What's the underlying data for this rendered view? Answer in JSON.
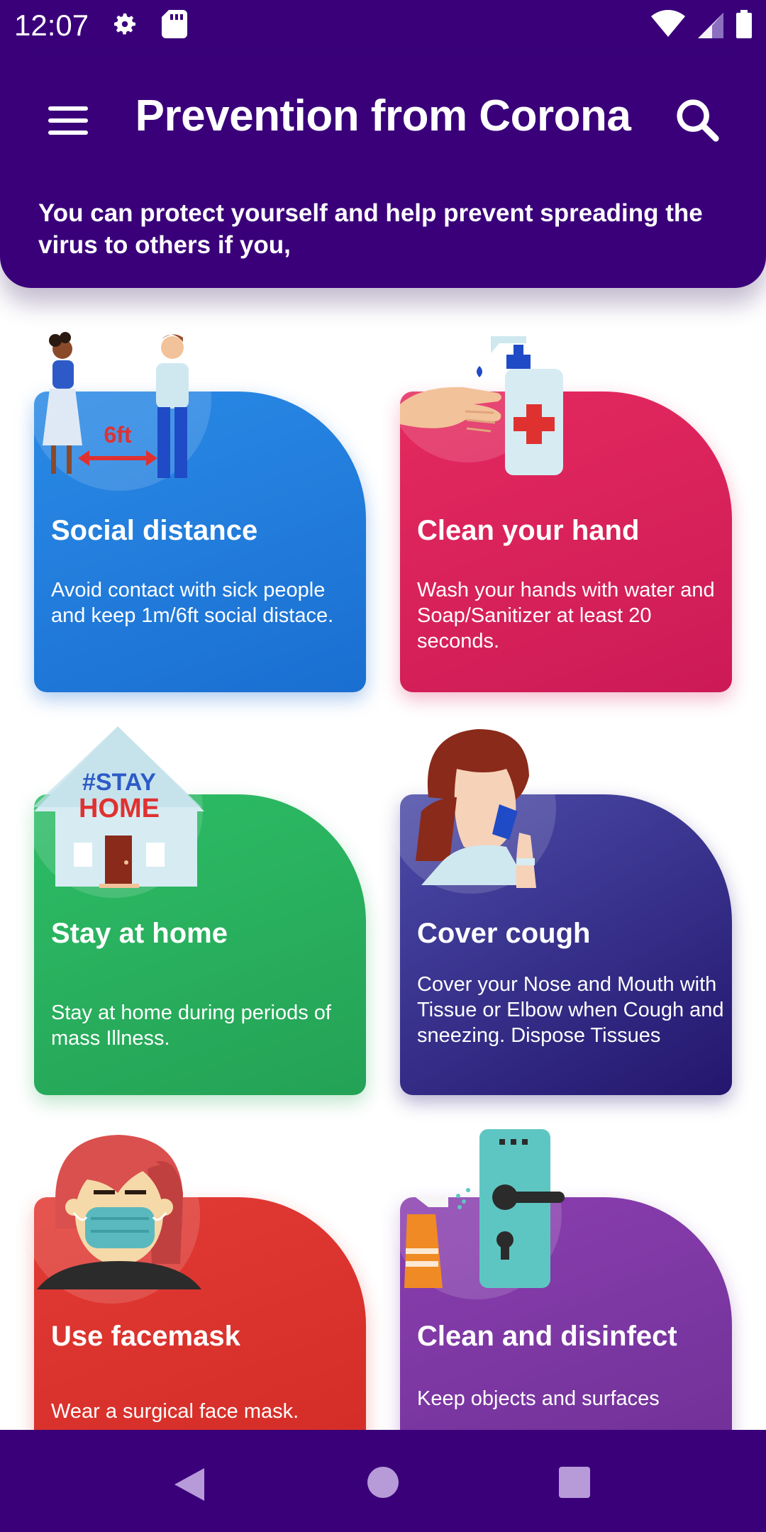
{
  "status_bar": {
    "time": "12:07"
  },
  "header": {
    "title": "Prevention from Corona",
    "intro": "You can protect yourself and help prevent spreading the virus to others if you,"
  },
  "cards": [
    {
      "title": "Social distance",
      "desc": "Avoid contact with sick people and keep 1m/6ft social distace.",
      "icon": "social-distance-illustration",
      "label": "6ft",
      "color": "#1f7fe0"
    },
    {
      "title": "Clean your hand",
      "desc": "Wash your hands with water and Soap/Sanitizer at least 20 seconds.",
      "icon": "hand-sanitizer-illustration",
      "color": "#dc1f5c"
    },
    {
      "title": "Stay at home",
      "desc": "Stay at home during periods of mass Illness.",
      "icon": "stay-home-illustration",
      "label_top": "#STAY",
      "label_bottom": "HOME",
      "color": "#2ab45f"
    },
    {
      "title": "Cover cough",
      "desc": "Cover your Nose and Mouth with Tissue or Elbow when Cough and sneezing. Dispose Tissues",
      "icon": "cover-cough-illustration",
      "color": "#3a2c8e"
    },
    {
      "title": "Use facemask",
      "desc": "Wear a surgical face mask.",
      "icon": "facemask-illustration",
      "color": "#dd342f"
    },
    {
      "title": "Clean and disinfect",
      "desc": "Keep objects and surfaces",
      "icon": "disinfect-illustration",
      "color": "#7e37a4"
    }
  ],
  "nav": {
    "back": "back-icon",
    "home": "home-icon",
    "recents": "recents-icon"
  }
}
